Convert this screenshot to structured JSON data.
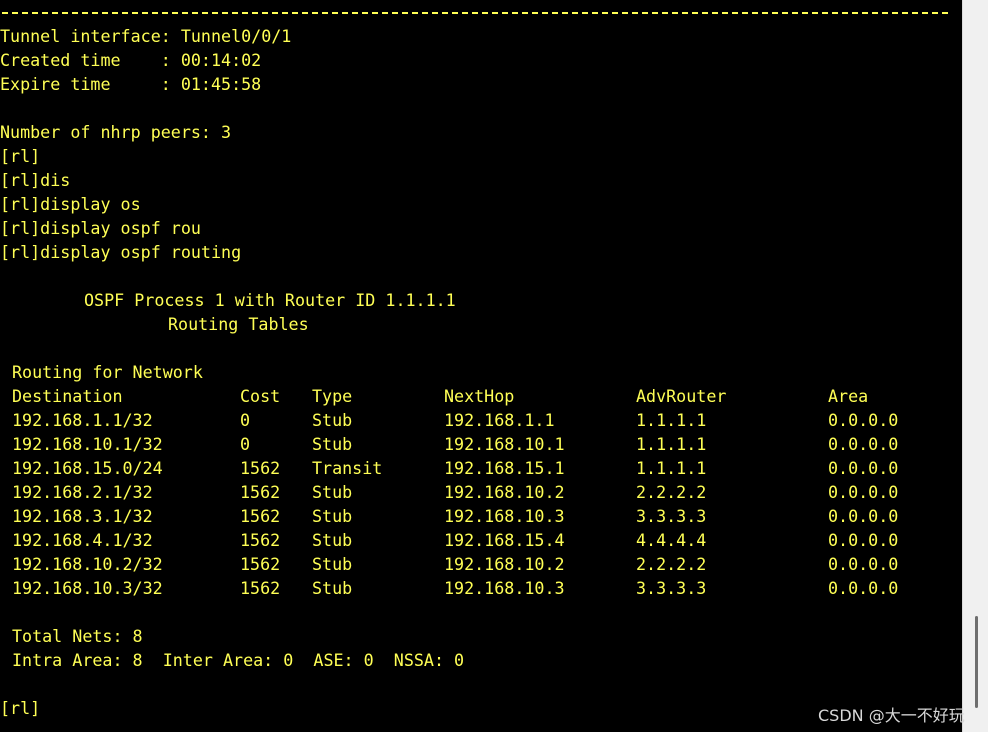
{
  "terminal": {
    "tunnel_interface": "Tunnel interface: Tunnel0/0/1",
    "created_time": "Created time    : 00:14:02",
    "expire_time": "Expire time     : 01:45:58",
    "nhrp_peers": "Number of nhrp peers: 3",
    "cmd1": "[rl]",
    "cmd2": "[rl]dis",
    "cmd3": "[rl]display os",
    "cmd4": "[rl]display ospf rou",
    "cmd5": "[rl]display ospf routing",
    "ospf_header": "OSPF Process 1 with Router ID 1.1.1.1",
    "routing_tables": "Routing Tables",
    "routing_for_network": "Routing for Network",
    "columns": [
      "Destination",
      "Cost",
      "Type",
      "NextHop",
      "AdvRouter",
      "Area"
    ],
    "rows": [
      [
        "192.168.1.1/32",
        "0",
        "Stub",
        "192.168.1.1",
        "1.1.1.1",
        "0.0.0.0"
      ],
      [
        "192.168.10.1/32",
        "0",
        "Stub",
        "192.168.10.1",
        "1.1.1.1",
        "0.0.0.0"
      ],
      [
        "192.168.15.0/24",
        "1562",
        "Transit",
        "192.168.15.1",
        "1.1.1.1",
        "0.0.0.0"
      ],
      [
        "192.168.2.1/32",
        "1562",
        "Stub",
        "192.168.10.2",
        "2.2.2.2",
        "0.0.0.0"
      ],
      [
        "192.168.3.1/32",
        "1562",
        "Stub",
        "192.168.10.3",
        "3.3.3.3",
        "0.0.0.0"
      ],
      [
        "192.168.4.1/32",
        "1562",
        "Stub",
        "192.168.15.4",
        "4.4.4.4",
        "0.0.0.0"
      ],
      [
        "192.168.10.2/32",
        "1562",
        "Stub",
        "192.168.10.2",
        "2.2.2.2",
        "0.0.0.0"
      ],
      [
        "192.168.10.3/32",
        "1562",
        "Stub",
        "192.168.10.3",
        "3.3.3.3",
        "0.0.0.0"
      ]
    ],
    "total_nets": "Total Nets: 8",
    "area_summary": "Intra Area: 8  Inter Area: 0  ASE: 0  NSSA: 0",
    "prompt": "[rl]"
  },
  "watermark": "CSDN @大一不好玩",
  "colors": {
    "background": "#000000",
    "foreground": "#ffff55"
  }
}
